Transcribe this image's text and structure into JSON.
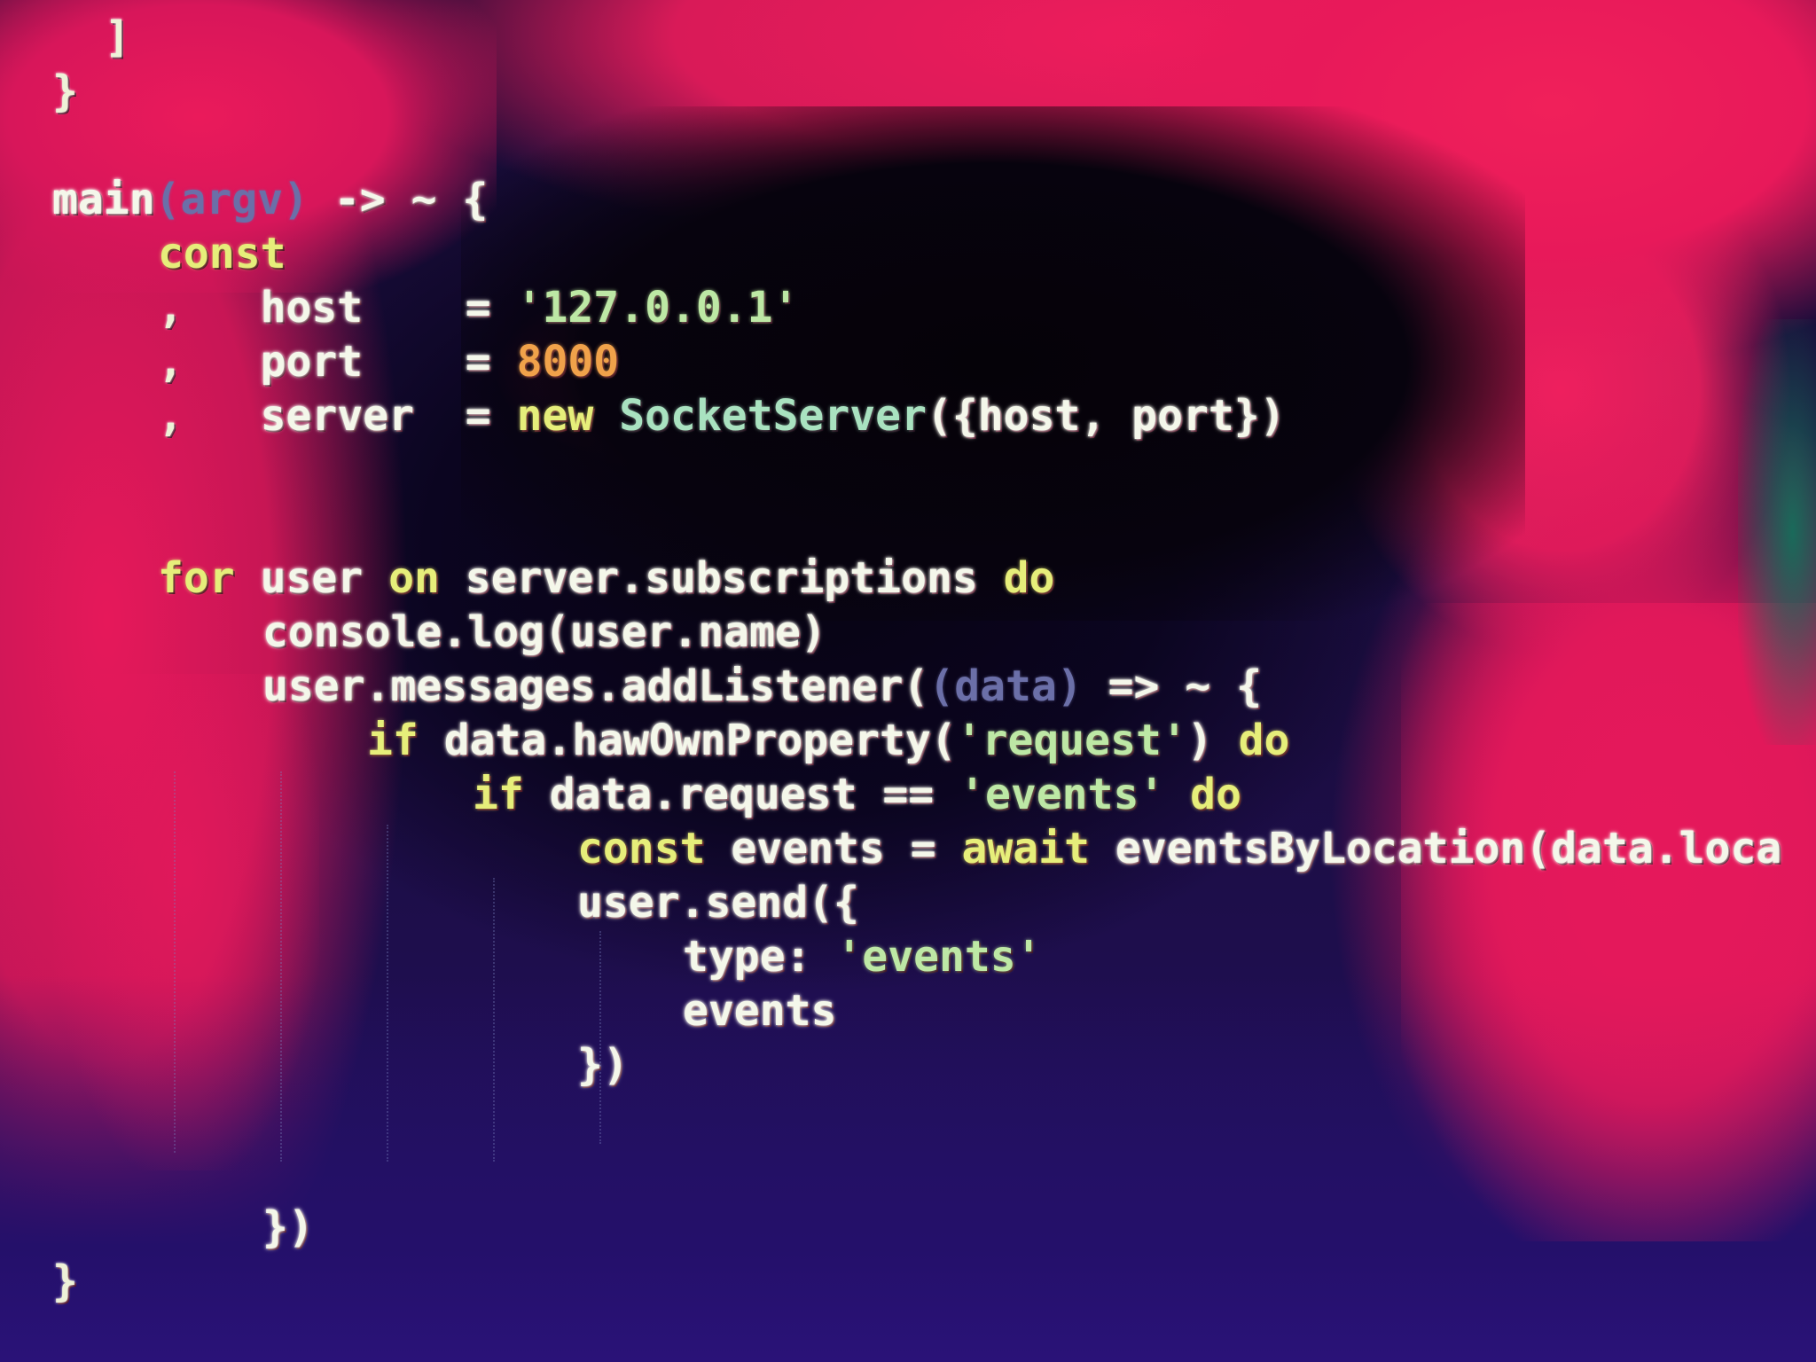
{
  "editor": {
    "theme_colors": {
      "background_dark": "#0a0418",
      "background_pink": "#e8195a",
      "background_blue": "#241062",
      "text_plain": "#f4f7ea",
      "keyword": "#e6ee7a",
      "string": "#bde8a5",
      "number": "#f0a24a",
      "class_name": "#a9e2c0",
      "parameter": "#6b6fa8"
    },
    "lines": [
      {
        "indent": 4,
        "tokens": [
          {
            "t": "]",
            "c": "punct"
          }
        ]
      },
      {
        "indent": 2,
        "tokens": [
          {
            "t": "}",
            "c": "punct"
          }
        ]
      },
      {
        "indent": 0,
        "tokens": []
      },
      {
        "indent": 2,
        "tokens": [
          {
            "t": "main",
            "c": "plain"
          },
          {
            "t": "(argv)",
            "c": "param"
          },
          {
            "t": " -> ~ {",
            "c": "plain"
          }
        ]
      },
      {
        "indent": 6,
        "tokens": [
          {
            "t": "const",
            "c": "kw"
          }
        ]
      },
      {
        "indent": 6,
        "tokens": [
          {
            "t": ",",
            "c": "punct"
          },
          {
            "t": "   host",
            "c": "plain"
          },
          {
            "t": "    = ",
            "c": "plain"
          },
          {
            "t": "'127.0.0.1'",
            "c": "str"
          }
        ]
      },
      {
        "indent": 6,
        "tokens": [
          {
            "t": ",",
            "c": "punct"
          },
          {
            "t": "   port",
            "c": "plain"
          },
          {
            "t": "    = ",
            "c": "plain"
          },
          {
            "t": "8000",
            "c": "num"
          }
        ]
      },
      {
        "indent": 6,
        "tokens": [
          {
            "t": ",",
            "c": "punct"
          },
          {
            "t": "   server",
            "c": "plain"
          },
          {
            "t": "  = ",
            "c": "plain"
          },
          {
            "t": "new",
            "c": "kw"
          },
          {
            "t": " SocketServer",
            "c": "cls"
          },
          {
            "t": "({host, port})",
            "c": "plain"
          }
        ]
      },
      {
        "indent": 0,
        "tokens": []
      },
      {
        "indent": 0,
        "tokens": []
      },
      {
        "indent": 6,
        "tokens": [
          {
            "t": "for",
            "c": "kw"
          },
          {
            "t": " user ",
            "c": "plain"
          },
          {
            "t": "on",
            "c": "kw"
          },
          {
            "t": " server.subscriptions ",
            "c": "plain"
          },
          {
            "t": "do",
            "c": "kw"
          }
        ]
      },
      {
        "indent": 10,
        "tokens": [
          {
            "t": "console.log(user.name)",
            "c": "plain"
          }
        ]
      },
      {
        "indent": 10,
        "tokens": [
          {
            "t": "user.messages.addListener(",
            "c": "plain"
          },
          {
            "t": "(data)",
            "c": "param"
          },
          {
            "t": " => ~ {",
            "c": "plain"
          }
        ]
      },
      {
        "indent": 14,
        "tokens": [
          {
            "t": "if",
            "c": "kw"
          },
          {
            "t": " data.hawOwnProperty(",
            "c": "plain"
          },
          {
            "t": "'request'",
            "c": "str"
          },
          {
            "t": ") ",
            "c": "plain"
          },
          {
            "t": "do",
            "c": "kw"
          }
        ]
      },
      {
        "indent": 18,
        "tokens": [
          {
            "t": "if",
            "c": "kw"
          },
          {
            "t": " data.request == ",
            "c": "plain"
          },
          {
            "t": "'events'",
            "c": "str"
          },
          {
            "t": " do",
            "c": "kw"
          }
        ]
      },
      {
        "indent": 22,
        "tokens": [
          {
            "t": "const",
            "c": "kw"
          },
          {
            "t": " events = ",
            "c": "plain"
          },
          {
            "t": "await",
            "c": "kw"
          },
          {
            "t": " eventsByLocation(data.loca",
            "c": "plain"
          }
        ]
      },
      {
        "indent": 22,
        "tokens": [
          {
            "t": "user.send({",
            "c": "plain"
          }
        ]
      },
      {
        "indent": 26,
        "tokens": [
          {
            "t": "type: ",
            "c": "plain"
          },
          {
            "t": "'events'",
            "c": "str"
          }
        ]
      },
      {
        "indent": 26,
        "tokens": [
          {
            "t": "events",
            "c": "plain"
          }
        ]
      },
      {
        "indent": 22,
        "tokens": [
          {
            "t": "})",
            "c": "plain"
          }
        ]
      },
      {
        "indent": 0,
        "tokens": []
      },
      {
        "indent": 0,
        "tokens": []
      },
      {
        "indent": 10,
        "tokens": [
          {
            "t": "})",
            "c": "plain"
          }
        ]
      },
      {
        "indent": 2,
        "tokens": [
          {
            "t": "}",
            "c": "punct"
          }
        ]
      }
    ]
  }
}
